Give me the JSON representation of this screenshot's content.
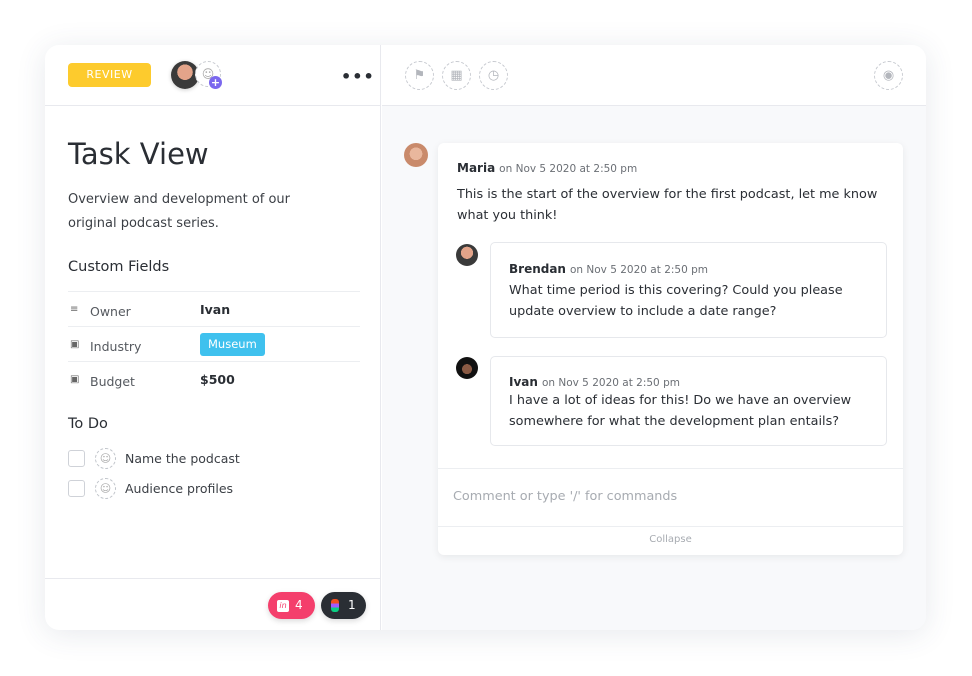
{
  "left": {
    "status": "REVIEW",
    "status_color": "#fdcb2d",
    "title": "Task View",
    "description": "Overview and development of our original podcast series.",
    "custom_fields_heading": "Custom Fields",
    "fields": [
      {
        "icon": "text-lines-icon",
        "label": "Owner",
        "value": "Ivan"
      },
      {
        "icon": "dropdown-icon",
        "label": "Industry",
        "value": "Museum",
        "tag_color": "#3fc1ee"
      },
      {
        "icon": "dropdown-icon",
        "label": "Budget",
        "value": "$500"
      }
    ],
    "todo_heading": "To Do",
    "todos": [
      {
        "label": "Name the podcast"
      },
      {
        "label": "Audience profiles"
      }
    ],
    "integrations": [
      {
        "name": "InVision",
        "count": "4",
        "color": "#f43f6c"
      },
      {
        "name": "Figma",
        "count": "1",
        "color": "#2a2e34"
      }
    ]
  },
  "comments": {
    "main": {
      "author": "Maria",
      "date": "on Nov 5 2020 at 2:50 pm",
      "text": "This is the start of the overview for the first podcast, let me know what you think!"
    },
    "replies": [
      {
        "author": "Brendan",
        "date": "on Nov 5 2020 at 2:50 pm",
        "text": "What time period is this covering? Could you please update overview to include a date range?"
      },
      {
        "author": "Ivan",
        "date": "on Nov 5 2020 at 2:50 pm",
        "text": "I have a lot of ideas for this! Do we have an overview somewhere for what the development plan entails?"
      }
    ],
    "placeholder": "Comment or type '/' for commands",
    "collapse": "Collapse"
  }
}
